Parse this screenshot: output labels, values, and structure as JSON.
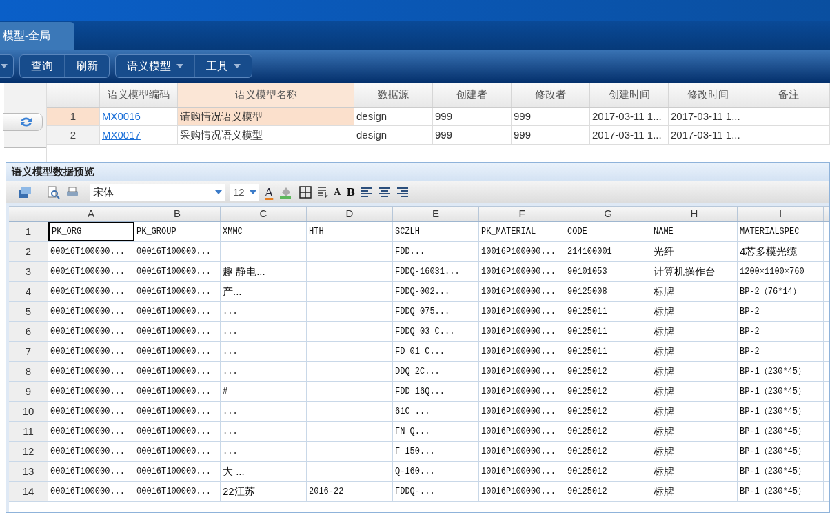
{
  "tab": {
    "label": "模型-全局",
    "selected": true
  },
  "toolbar": {
    "groups": [
      [
        {
          "has_menu": true
        }
      ],
      [
        {
          "label": "查询",
          "has_menu": false
        },
        {
          "label": "刷新",
          "has_menu": false
        }
      ],
      [
        {
          "label": "语义模型",
          "has_menu": true
        },
        {
          "label": "工具",
          "has_menu": true
        }
      ]
    ]
  },
  "models_table": {
    "columns": [
      {
        "selected": false
      },
      {
        "label": "语义模型编码",
        "selected": false
      },
      {
        "label": "语义模型名称",
        "selected": true
      },
      {
        "label": "数据源",
        "selected": false
      },
      {
        "label": "创建者",
        "selected": false
      },
      {
        "label": "修改者",
        "selected": false
      },
      {
        "label": "创建时间",
        "selected": false
      },
      {
        "label": "修改时间",
        "selected": false
      },
      {
        "label": "备注",
        "selected": false
      }
    ],
    "rows": [
      {
        "selected": true,
        "cells": [
          "1",
          "MX0016",
          "请购情况语义模型",
          "design",
          "999",
          "999",
          "2017-03-11 1...",
          "2017-03-11 1...",
          ""
        ]
      },
      {
        "selected": false,
        "cells": [
          "2",
          "MX0017",
          "采购情况语义模型",
          "design",
          "999",
          "999",
          "2017-03-11 1...",
          "2017-03-11 1...",
          ""
        ]
      }
    ]
  },
  "preview": {
    "title": "语义模型数据预览",
    "toolbar": {
      "font": "宋体",
      "size": "12",
      "font_color_label": "A",
      "font_grow_label": "A",
      "bold_label": "B"
    },
    "columns": [
      "",
      "A",
      "B",
      "C",
      "D",
      "E",
      "F",
      "G",
      "H",
      "I"
    ],
    "rows": [
      {
        "cells": [
          {
            "text": "1",
            "selected": false
          },
          {
            "text": "PK_ORG",
            "selected": true
          },
          {
            "text": "PK_GROUP",
            "selected": false
          },
          {
            "text": "XMMC",
            "selected": false
          },
          {
            "text": "HTH",
            "selected": false
          },
          {
            "text": "SCZLH",
            "selected": false
          },
          {
            "text": "PK_MATERIAL",
            "selected": false
          },
          {
            "text": "CODE",
            "selected": false
          },
          {
            "text": "NAME",
            "selected": false
          },
          {
            "text": "MATERIALSPEC",
            "selected": false
          }
        ]
      },
      {
        "cells": [
          {
            "text": "2",
            "selected": false
          },
          {
            "text": "00016T100000...",
            "selected": false
          },
          {
            "text": "00016T100000...",
            "selected": false
          },
          {
            "text": "",
            "selected": false
          },
          {
            "text": "",
            "selected": false
          },
          {
            "text": "FDD...",
            "selected": false
          },
          {
            "text": "10016P100000...",
            "selected": false
          },
          {
            "text": "214100001",
            "selected": false
          },
          {
            "text": "光纤",
            "selected": false
          },
          {
            "text": "4芯多模光缆",
            "selected": false
          }
        ]
      },
      {
        "cells": [
          {
            "text": "3",
            "selected": false
          },
          {
            "text": "00016T100000...",
            "selected": false
          },
          {
            "text": "00016T100000...",
            "selected": false
          },
          {
            "text": "趣 静电...",
            "selected": false
          },
          {
            "text": "",
            "selected": false
          },
          {
            "text": "FDDQ-16031...",
            "selected": false
          },
          {
            "text": "10016P100000...",
            "selected": false
          },
          {
            "text": "90101053",
            "selected": false
          },
          {
            "text": "计算机操作台",
            "selected": false
          },
          {
            "text": "1200×1100×760",
            "selected": false
          }
        ]
      },
      {
        "cells": [
          {
            "text": "4",
            "selected": false
          },
          {
            "text": "00016T100000...",
            "selected": false
          },
          {
            "text": "00016T100000...",
            "selected": false
          },
          {
            "text": "产...",
            "selected": false
          },
          {
            "text": "",
            "selected": false
          },
          {
            "text": "FDDQ-002...",
            "selected": false
          },
          {
            "text": "10016P100000...",
            "selected": false
          },
          {
            "text": "90125008",
            "selected": false
          },
          {
            "text": "标牌",
            "selected": false
          },
          {
            "text": "BP-2（76*14）",
            "selected": false
          }
        ]
      },
      {
        "cells": [
          {
            "text": "5",
            "selected": false
          },
          {
            "text": "00016T100000...",
            "selected": false
          },
          {
            "text": "00016T100000...",
            "selected": false
          },
          {
            "text": "...",
            "selected": false
          },
          {
            "text": "",
            "selected": false
          },
          {
            "text": "FDDQ 075...",
            "selected": false
          },
          {
            "text": "10016P100000...",
            "selected": false
          },
          {
            "text": "90125011",
            "selected": false
          },
          {
            "text": "标牌",
            "selected": false
          },
          {
            "text": "BP-2",
            "selected": false
          }
        ]
      },
      {
        "cells": [
          {
            "text": "6",
            "selected": false
          },
          {
            "text": "00016T100000...",
            "selected": false
          },
          {
            "text": "00016T100000...",
            "selected": false
          },
          {
            "text": "...",
            "selected": false
          },
          {
            "text": "",
            "selected": false
          },
          {
            "text": "FDDQ 03 C...",
            "selected": false
          },
          {
            "text": "10016P100000...",
            "selected": false
          },
          {
            "text": "90125011",
            "selected": false
          },
          {
            "text": "标牌",
            "selected": false
          },
          {
            "text": "BP-2",
            "selected": false
          }
        ]
      },
      {
        "cells": [
          {
            "text": "7",
            "selected": false
          },
          {
            "text": "00016T100000...",
            "selected": false
          },
          {
            "text": "00016T100000...",
            "selected": false
          },
          {
            "text": "...",
            "selected": false
          },
          {
            "text": "",
            "selected": false
          },
          {
            "text": "FD 01 C...",
            "selected": false
          },
          {
            "text": "10016P100000...",
            "selected": false
          },
          {
            "text": "90125011",
            "selected": false
          },
          {
            "text": "标牌",
            "selected": false
          },
          {
            "text": "BP-2",
            "selected": false
          }
        ]
      },
      {
        "cells": [
          {
            "text": "8",
            "selected": false
          },
          {
            "text": "00016T100000...",
            "selected": false
          },
          {
            "text": "00016T100000...",
            "selected": false
          },
          {
            "text": "...",
            "selected": false
          },
          {
            "text": "",
            "selected": false
          },
          {
            "text": "DDQ 2C...",
            "selected": false
          },
          {
            "text": "10016P100000...",
            "selected": false
          },
          {
            "text": "90125012",
            "selected": false
          },
          {
            "text": "标牌",
            "selected": false
          },
          {
            "text": "BP-1（230*45）",
            "selected": false
          }
        ]
      },
      {
        "cells": [
          {
            "text": "9",
            "selected": false
          },
          {
            "text": "00016T100000...",
            "selected": false
          },
          {
            "text": "00016T100000...",
            "selected": false
          },
          {
            "text": "#",
            "selected": false
          },
          {
            "text": "",
            "selected": false
          },
          {
            "text": "FDD 16Q...",
            "selected": false
          },
          {
            "text": "10016P100000...",
            "selected": false
          },
          {
            "text": "90125012",
            "selected": false
          },
          {
            "text": "标牌",
            "selected": false
          },
          {
            "text": "BP-1（230*45）",
            "selected": false
          }
        ]
      },
      {
        "cells": [
          {
            "text": "10",
            "selected": false
          },
          {
            "text": "00016T100000...",
            "selected": false
          },
          {
            "text": "00016T100000...",
            "selected": false
          },
          {
            "text": "...",
            "selected": false
          },
          {
            "text": "",
            "selected": false
          },
          {
            "text": "61C ...",
            "selected": false
          },
          {
            "text": "10016P100000...",
            "selected": false
          },
          {
            "text": "90125012",
            "selected": false
          },
          {
            "text": "标牌",
            "selected": false
          },
          {
            "text": "BP-1（230*45）",
            "selected": false
          }
        ]
      },
      {
        "cells": [
          {
            "text": "11",
            "selected": false
          },
          {
            "text": "00016T100000...",
            "selected": false
          },
          {
            "text": "00016T100000...",
            "selected": false
          },
          {
            "text": "...",
            "selected": false
          },
          {
            "text": "",
            "selected": false
          },
          {
            "text": "FN Q...",
            "selected": false
          },
          {
            "text": "10016P100000...",
            "selected": false
          },
          {
            "text": "90125012",
            "selected": false
          },
          {
            "text": "标牌",
            "selected": false
          },
          {
            "text": "BP-1（230*45）",
            "selected": false
          }
        ]
      },
      {
        "cells": [
          {
            "text": "12",
            "selected": false
          },
          {
            "text": "00016T100000...",
            "selected": false
          },
          {
            "text": "00016T100000...",
            "selected": false
          },
          {
            "text": "...",
            "selected": false
          },
          {
            "text": "",
            "selected": false
          },
          {
            "text": "F 150...",
            "selected": false
          },
          {
            "text": "10016P100000...",
            "selected": false
          },
          {
            "text": "90125012",
            "selected": false
          },
          {
            "text": "标牌",
            "selected": false
          },
          {
            "text": "BP-1（230*45）",
            "selected": false
          }
        ]
      },
      {
        "cells": [
          {
            "text": "13",
            "selected": false
          },
          {
            "text": "00016T100000...",
            "selected": false
          },
          {
            "text": "00016T100000...",
            "selected": false
          },
          {
            "text": "大 ...",
            "selected": false
          },
          {
            "text": "",
            "selected": false
          },
          {
            "text": "Q-160...",
            "selected": false
          },
          {
            "text": "10016P100000...",
            "selected": false
          },
          {
            "text": "90125012",
            "selected": false
          },
          {
            "text": "标牌",
            "selected": false
          },
          {
            "text": "BP-1（230*45）",
            "selected": false
          }
        ]
      },
      {
        "cells": [
          {
            "text": "14",
            "selected": false
          },
          {
            "text": "00016T100000...",
            "selected": false
          },
          {
            "text": "00016T100000...",
            "selected": false
          },
          {
            "text": "22江苏",
            "selected": false
          },
          {
            "text": "2016-22",
            "selected": false
          },
          {
            "text": "FDDQ-...",
            "selected": false
          },
          {
            "text": "10016P100000...",
            "selected": false
          },
          {
            "text": "90125012",
            "selected": false
          },
          {
            "text": "标牌",
            "selected": false
          },
          {
            "text": "BP-1（230*45）",
            "selected": false
          }
        ]
      }
    ]
  }
}
